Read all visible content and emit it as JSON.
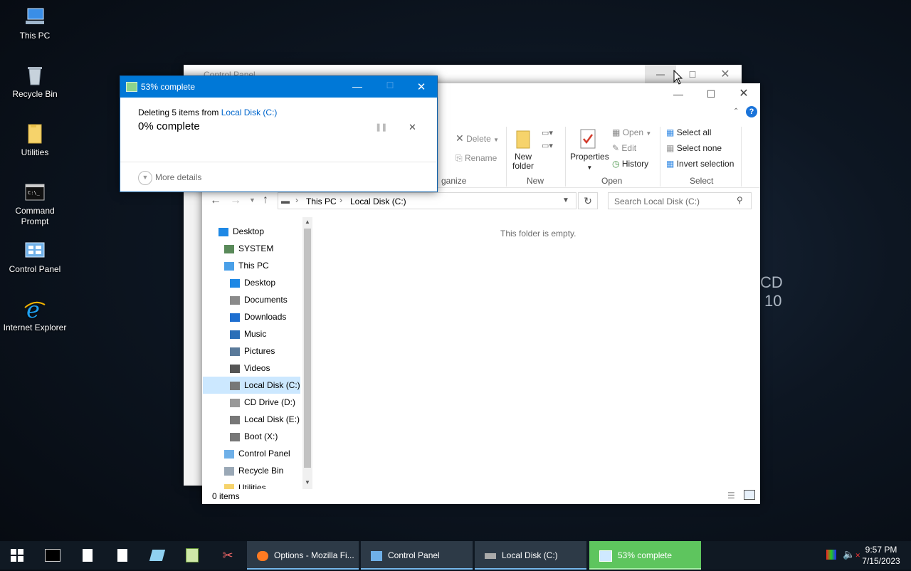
{
  "desktop": {
    "icons": [
      {
        "label": "This PC"
      },
      {
        "label": "Recycle Bin"
      },
      {
        "label": "Utilities"
      },
      {
        "label": "Command Prompt"
      },
      {
        "label": "Control Panel"
      },
      {
        "label": "Internet Explorer"
      }
    ],
    "brand_line1": "CD",
    "brand_line2": "10"
  },
  "control_panel_window": {
    "title": "Control Panel"
  },
  "explorer": {
    "ribbon": {
      "delete": "Delete",
      "rename": "Rename",
      "new_folder_1": "New",
      "new_folder_2": "folder",
      "properties": "Properties",
      "open": "Open",
      "edit": "Edit",
      "history": "History",
      "select_all": "Select all",
      "select_none": "Select none",
      "invert_selection": "Invert selection",
      "group_organize": "ganize",
      "group_new": "New",
      "group_open": "Open",
      "group_select": "Select"
    },
    "address": {
      "crumb1": "This PC",
      "crumb2": "Local Disk (C:)"
    },
    "search_placeholder": "Search Local Disk (C:)",
    "nav": [
      {
        "label": "Desktop",
        "icon": "desktop-icon"
      },
      {
        "label": "SYSTEM",
        "icon": "user-icon"
      },
      {
        "label": "This PC",
        "icon": "pc-icon"
      },
      {
        "label": "Desktop",
        "icon": "desktop-icon"
      },
      {
        "label": "Documents",
        "icon": "documents-icon"
      },
      {
        "label": "Downloads",
        "icon": "downloads-icon"
      },
      {
        "label": "Music",
        "icon": "music-icon"
      },
      {
        "label": "Pictures",
        "icon": "pictures-icon"
      },
      {
        "label": "Videos",
        "icon": "videos-icon"
      },
      {
        "label": "Local Disk (C:)",
        "icon": "drive-icon"
      },
      {
        "label": "CD Drive (D:)",
        "icon": "cd-drive-icon"
      },
      {
        "label": "Local Disk (E:)",
        "icon": "drive-icon"
      },
      {
        "label": "Boot (X:)",
        "icon": "drive-icon"
      },
      {
        "label": "Control Panel",
        "icon": "control-panel-icon"
      },
      {
        "label": "Recycle Bin",
        "icon": "recycle-bin-icon"
      },
      {
        "label": "Utilities",
        "icon": "folder-icon"
      }
    ],
    "empty_message": "This folder is empty.",
    "status": "0 items"
  },
  "progress_dialog": {
    "title": "53% complete",
    "line_prefix": "Deleting 5 items from ",
    "line_link": "Local Disk (C:)",
    "percent_text": "0% complete",
    "more_details": "More details"
  },
  "taskbar": {
    "tasks": [
      {
        "label": "Options - Mozilla Fi..."
      },
      {
        "label": "Control Panel"
      },
      {
        "label": "Local Disk (C:)"
      },
      {
        "label": "53% complete"
      }
    ],
    "time": "9:57 PM",
    "date": "7/15/2023"
  },
  "colors": {
    "accent": "#0078d7",
    "link": "#0066cc",
    "active_task": "#5ec55e"
  }
}
